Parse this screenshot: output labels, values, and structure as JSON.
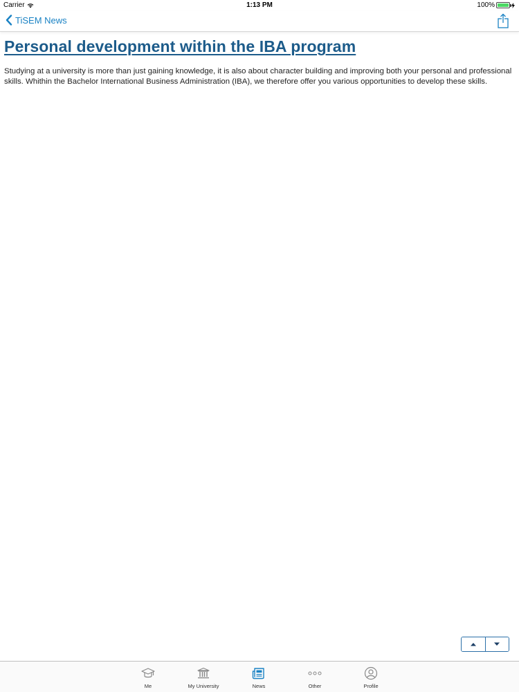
{
  "status_bar": {
    "carrier": "Carrier",
    "time": "1:13 PM",
    "battery": "100%",
    "battery_level": 1.0
  },
  "nav": {
    "back_label": "TiSEM News",
    "back_icon": "chevron-left-icon",
    "share_icon": "share-icon"
  },
  "article": {
    "title": "Personal development within the IBA program",
    "body": "Studying at a university is more than just gaining knowledge, it is also about character building and improving both your personal and professional skills. Whithin the Bachelor International Business Administration (IBA), we therefore offer you various opportunities to develop these skills."
  },
  "pager": {
    "up_icon": "triangle-up-icon",
    "down_icon": "triangle-down-icon"
  },
  "tabs": [
    {
      "label": "Me",
      "icon": "graduation-cap-icon",
      "active": false
    },
    {
      "label": "My University",
      "icon": "university-building-icon",
      "active": false
    },
    {
      "label": "News",
      "icon": "newspaper-icon",
      "active": true
    },
    {
      "label": "Other",
      "icon": "more-dots-icon",
      "active": false
    },
    {
      "label": "Profile",
      "icon": "profile-icon",
      "active": false
    }
  ],
  "colors": {
    "accent": "#1a82c4",
    "title": "#1c5b8a",
    "battery": "#4cd964"
  }
}
